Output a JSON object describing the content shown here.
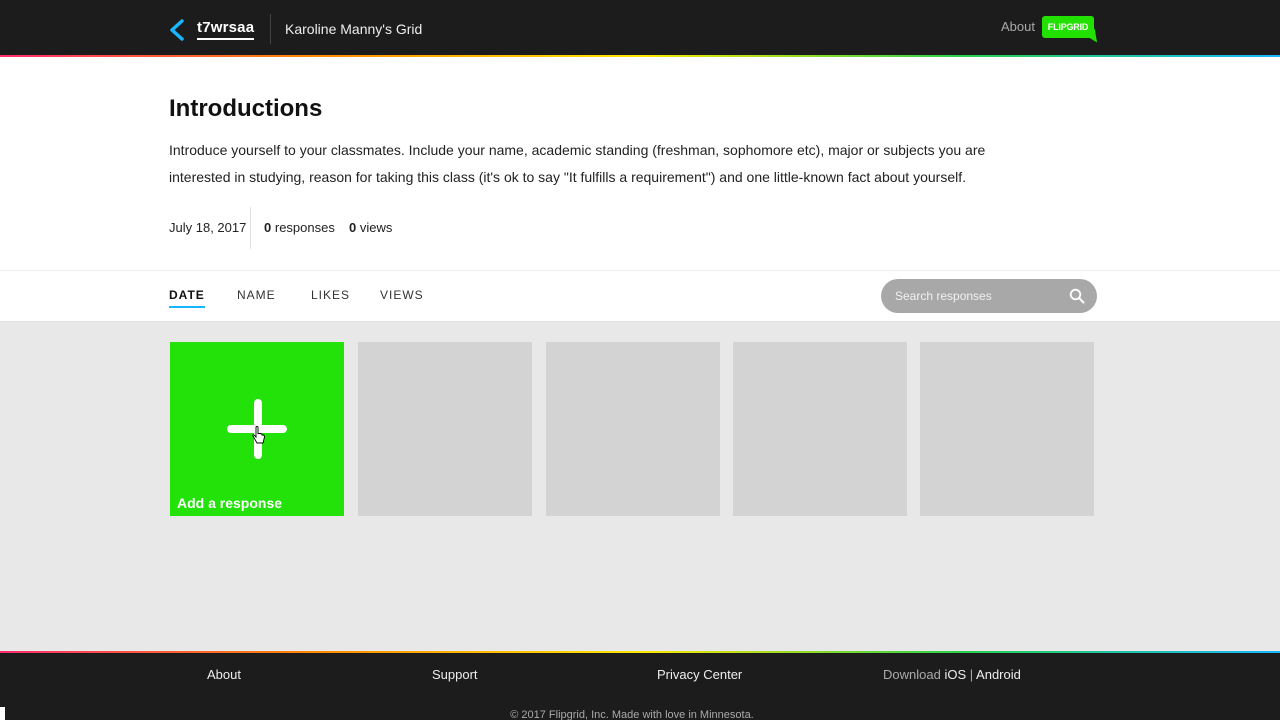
{
  "header": {
    "code": "t7wrsaa",
    "grid_name": "Karoline Manny's Grid",
    "about_label": "About",
    "logo_text": "FLIPGRID"
  },
  "topic": {
    "title": "Introductions",
    "description": "Introduce yourself to your classmates. Include your name, academic standing (freshman, sophomore etc), major or subjects you are interested in studying, reason for taking this class (it's ok to say \"It fulfills a requirement\") and one little-known fact about yourself.",
    "date": "July 18, 2017",
    "responses_count": "0",
    "responses_label": "responses",
    "views_count": "0",
    "views_label": "views"
  },
  "sort": {
    "tabs": [
      {
        "label": "DATE",
        "active": true
      },
      {
        "label": "NAME",
        "active": false
      },
      {
        "label": "LIKES",
        "active": false
      },
      {
        "label": "VIEWS",
        "active": false
      }
    ],
    "search_placeholder": "Search responses"
  },
  "tiles": {
    "add_label": "Add a response",
    "placeholder_count": 4
  },
  "footer": {
    "links": [
      "About",
      "Support",
      "Privacy Center"
    ],
    "download_label": "Download",
    "download_ios": "iOS",
    "download_sep": "|",
    "download_android": "Android",
    "copyright": "© 2017 Flipgrid, Inc. Made with love in Minnesota."
  },
  "colors": {
    "brand_green": "#22e20a",
    "accent_blue": "#19b6ff",
    "dark": "#1c1c1c"
  }
}
